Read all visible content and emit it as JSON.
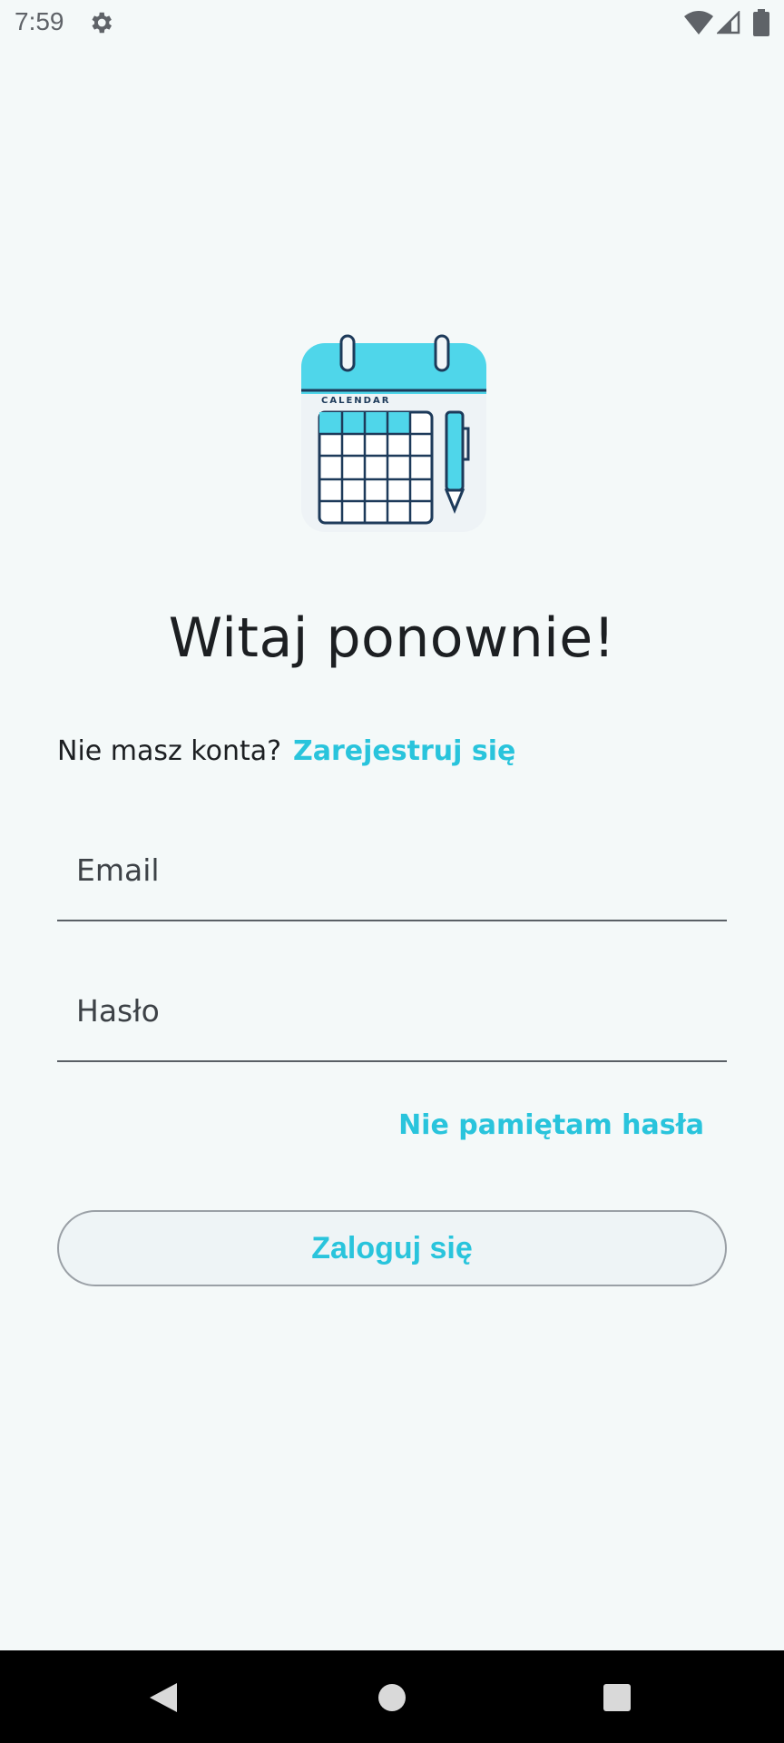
{
  "status_bar": {
    "time": "7:59",
    "icons": [
      "gear-icon",
      "wifi-icon",
      "signal-icon",
      "battery-icon"
    ]
  },
  "logo": {
    "icon": "calendar-icon",
    "text": "CALENDAR"
  },
  "login": {
    "title": "Witaj ponownie!",
    "signup_prompt": "Nie masz konta?",
    "signup_link": "Zarejestruj się",
    "email_placeholder": "Email",
    "password_placeholder": "Hasło",
    "forgot_password": "Nie pamiętam hasła",
    "login_button": "Zaloguj się"
  },
  "nav_bar": {
    "icons": [
      "back-icon",
      "home-icon",
      "recents-icon"
    ]
  },
  "colors": {
    "accent": "#29c4dc",
    "background": "#f4f9f9",
    "text": "#1c1f22"
  }
}
